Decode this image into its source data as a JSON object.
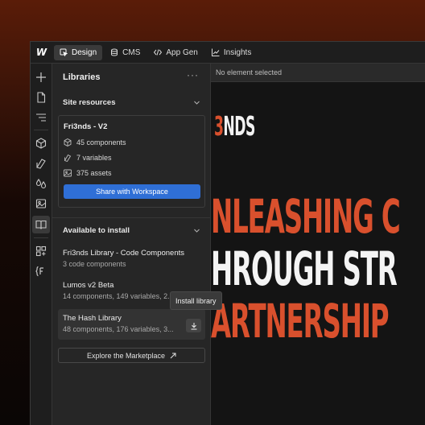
{
  "topbar": {
    "logo": "W",
    "tabs": [
      {
        "label": "Design",
        "active": true,
        "icon": "design-cursor-icon"
      },
      {
        "label": "CMS",
        "active": false,
        "icon": "database-icon"
      },
      {
        "label": "App Gen",
        "active": false,
        "icon": "code-icon"
      },
      {
        "label": "Insights",
        "active": false,
        "icon": "chart-line-icon"
      }
    ]
  },
  "iconbar": {
    "items": [
      "add-icon",
      "page-icon",
      "navigator-icon",
      "components-icon",
      "styles-icon",
      "variables-icon",
      "assets-icon",
      "libraries-icon",
      "apps-icon",
      "fonts-icon"
    ],
    "active": "libraries-icon"
  },
  "panel": {
    "title": "Libraries",
    "more": "···",
    "site_resources": {
      "heading": "Site resources",
      "site_name": "Fri3nds - V2",
      "components": "45 components",
      "variables": "7 variables",
      "assets": "375 assets",
      "share_label": "Share with Workspace"
    },
    "available": {
      "heading": "Available to install",
      "libraries": [
        {
          "name": "Fri3nds Library - Code Components",
          "desc": "3 code components"
        },
        {
          "name": "Lumos v2 Beta",
          "desc": "14 components, 149 variables, 2..."
        },
        {
          "name": "The Hash Library",
          "desc": "48 components, 176 variables, 3..."
        }
      ],
      "tooltip": "Install library",
      "marketplace_label": "Explore the Marketplace"
    }
  },
  "canvas": {
    "status": "No element selected",
    "brand_accent": "3",
    "brand_rest": "NDS",
    "lines": [
      "NLEASHING C",
      "HROUGH STR",
      "ARTNERSHIP"
    ]
  },
  "colors": {
    "accent_blue": "#2f6fd6",
    "brand_orange": "#d9502d",
    "panel_bg": "#262626"
  }
}
